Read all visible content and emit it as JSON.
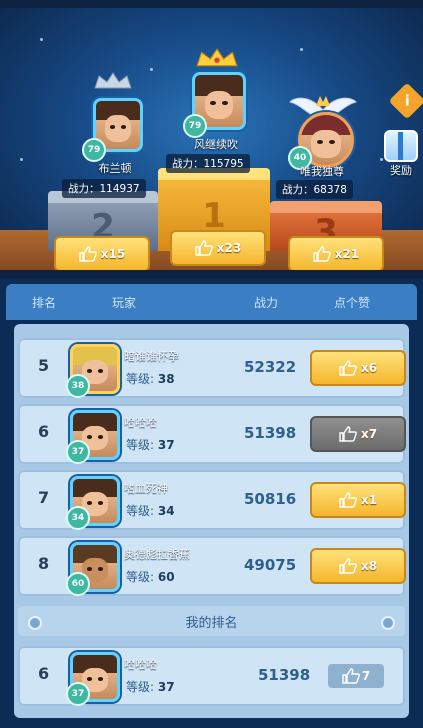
{
  "podium": [
    {
      "rank": "2",
      "name": "布兰顿",
      "power": "战力：114937",
      "level": "79",
      "likes": "x15"
    },
    {
      "rank": "1",
      "name": "风继续吹",
      "power": "战力：115795",
      "level": "79",
      "likes": "x23"
    },
    {
      "rank": "3",
      "name": "唯我独尊",
      "power": "战力：68378",
      "level": "40",
      "likes": "x21"
    }
  ],
  "side": {
    "info_icon": "i",
    "reward_label": "奖励"
  },
  "header": {
    "col_rank": "排名",
    "col_player": "玩家",
    "col_power": "战力",
    "col_like": "点个赞"
  },
  "rows": [
    {
      "rank": "5",
      "name": "暗谁谁怀孕",
      "level_label": "等级:",
      "level": "38",
      "avatar_level": "38",
      "power": "52322",
      "likes": "x6",
      "btn_style": "gold"
    },
    {
      "rank": "6",
      "name": "哈哈哈",
      "level_label": "等级:",
      "level": "37",
      "avatar_level": "37",
      "power": "51398",
      "likes": "x7",
      "btn_style": "gray"
    },
    {
      "rank": "7",
      "name": "嗜血死神",
      "level_label": "等级:",
      "level": "34",
      "avatar_level": "34",
      "power": "50816",
      "likes": "x1",
      "btn_style": "gold"
    },
    {
      "rank": "8",
      "name": "奥德彪拉香蕉",
      "level_label": "等级:",
      "level": "60",
      "avatar_level": "60",
      "power": "49075",
      "likes": "x8",
      "btn_style": "gold"
    }
  ],
  "my_rank": {
    "title": "我的排名",
    "rank": "6",
    "name": "哈哈哈",
    "level_label": "等级:",
    "level": "37",
    "avatar_level": "37",
    "power": "51398",
    "likes": "7"
  },
  "colors": {
    "accent_gold": "#f4b62c",
    "panel_blue": "#3c7ec4",
    "list_bg": "#a8c9e6"
  }
}
